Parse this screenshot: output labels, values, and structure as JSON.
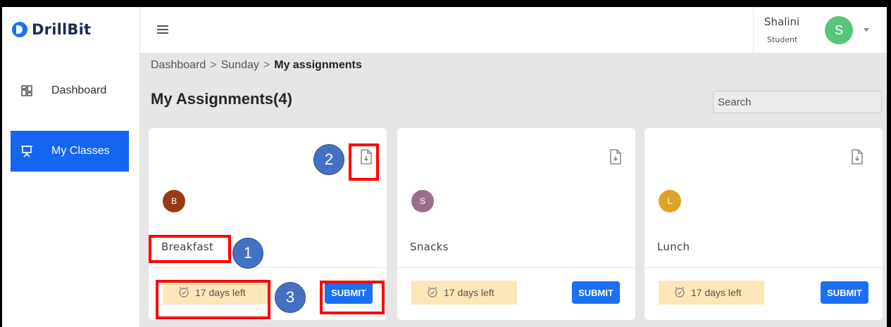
{
  "app": {
    "logo_text": "DrillBit"
  },
  "sidebar": {
    "items": [
      {
        "label": "Dashboard",
        "icon": "dashboard-grid-icon",
        "active": false
      },
      {
        "label": "My Classes",
        "icon": "presentation-board-icon",
        "active": true
      }
    ]
  },
  "header": {
    "menu_icon": "hamburger-menu-icon",
    "user": {
      "name": "Shalini",
      "role": "Student",
      "initial": "S",
      "avatar_color": "#5ac47a"
    }
  },
  "breadcrumb": {
    "items": [
      "Dashboard",
      "Sunday"
    ],
    "current": "My assignments",
    "separator": ">"
  },
  "page": {
    "title": "My Assignments(4)"
  },
  "search": {
    "placeholder": "Search"
  },
  "assignments": [
    {
      "name": "Breakfast",
      "initial": "B",
      "color": "#9a3a14",
      "days_left": "17 days left",
      "submit_label": "SUBMIT",
      "download_icon": "file-download-icon"
    },
    {
      "name": "Snacks",
      "initial": "S",
      "color": "#9c6e8c",
      "days_left": "17 days left",
      "submit_label": "SUBMIT",
      "download_icon": "file-download-icon"
    },
    {
      "name": "Lunch",
      "initial": "L",
      "color": "#dea22a",
      "days_left": "17 days left",
      "submit_label": "SUBMIT",
      "download_icon": "file-download-icon"
    }
  ],
  "annotations": [
    {
      "number": "1",
      "target": "Breakfast"
    },
    {
      "number": "2",
      "target": "download"
    },
    {
      "number": "3",
      "target": "days left and submit"
    }
  ],
  "colors": {
    "accent": "#1565f3",
    "highlight": "#ff0000",
    "marker": "#4471c4",
    "days_bg": "#fce7b8"
  }
}
